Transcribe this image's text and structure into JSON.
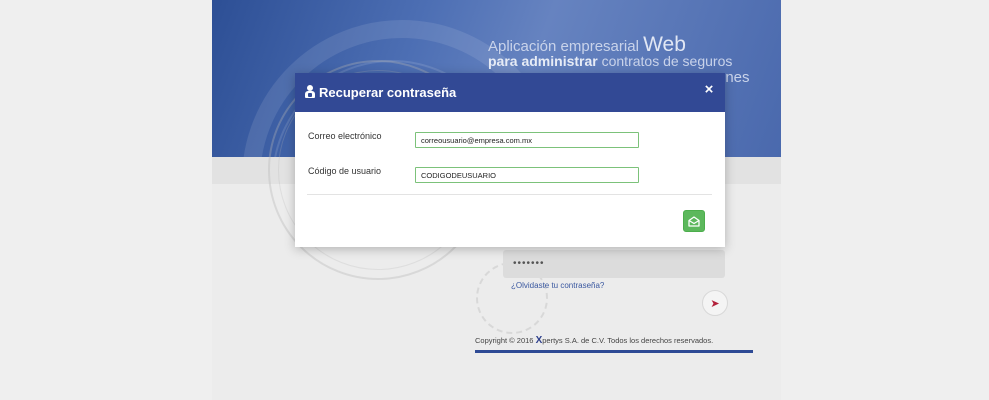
{
  "background": {
    "tagline": {
      "line1": "Aplicación empresarial",
      "line1_big": "Web",
      "line2_bold": "para administrar",
      "line2_rest": "contratos de seguros",
      "line3": "ones"
    },
    "password_masked": "•••••••",
    "forgot_link": "¿Olvidaste tu contraseña?",
    "copyright_pre": "Copyright © 2016",
    "copyright_brand_x": "X",
    "copyright_post": "pertys S.A. de C.V. Todos los derechos reservados."
  },
  "modal": {
    "title": "Recuperar contraseña",
    "close_glyph": "×",
    "email": {
      "label": "Correo electrónico",
      "value": "correousuario@empresa.com.mx"
    },
    "user_code": {
      "label": "Código de usuario",
      "value": "CODIGODEUSUARIO"
    }
  },
  "colors": {
    "header": "#324995",
    "send_button": "#5cb85c",
    "input_border": "#7cc27a"
  }
}
